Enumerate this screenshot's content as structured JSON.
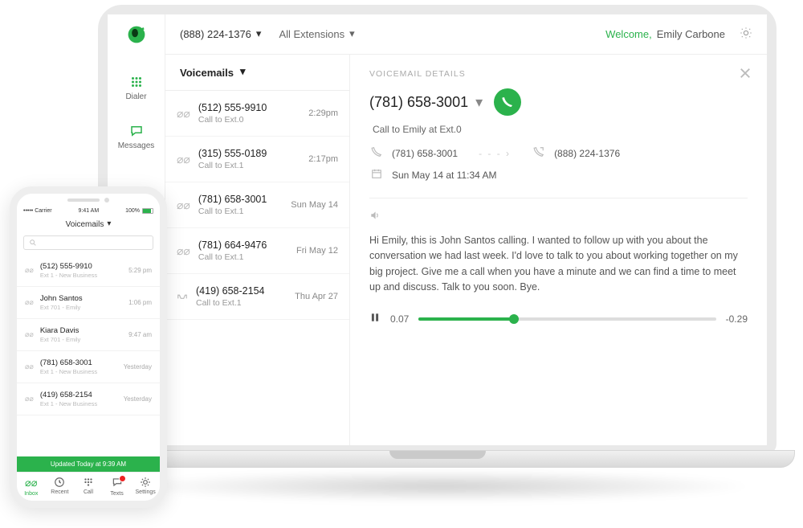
{
  "desktop": {
    "topbar": {
      "phone": "(888) 224-1376",
      "extensions_label": "All Extensions",
      "welcome": "Welcome,",
      "user": "Emily Carbone"
    },
    "rail": {
      "dialer": "Dialer",
      "messages": "Messages"
    },
    "vm_header": "Voicemails",
    "voicemails": [
      {
        "number": "(512) 555-9910",
        "ext": "Call to Ext.0",
        "time": "2:29pm"
      },
      {
        "number": "(315) 555-0189",
        "ext": "Call to Ext.1",
        "time": "2:17pm"
      },
      {
        "number": "(781) 658-3001",
        "ext": "Call to Ext.1",
        "time": "Sun May 14"
      },
      {
        "number": "(781) 664-9476",
        "ext": "Call to Ext.1",
        "time": "Fri May 12"
      },
      {
        "number": "(419) 658-2154",
        "ext": "Call to Ext.1",
        "time": "Thu Apr 27"
      }
    ],
    "details": {
      "title": "VOICEMAIL DETAILS",
      "number": "(781) 658-3001",
      "call_to": "Call to Emily at Ext.0",
      "from": "(781) 658-3001",
      "to": "(888) 224-1376",
      "date": "Sun May 14 at 11:34 AM",
      "transcript": "Hi Emily, this is John Santos calling. I wanted to follow up with you about the conversation we had last week. I'd love to talk to you about working together on my big project. Give me a call when you have a minute and we can find a time to meet up and discuss. Talk to you soon. Bye.",
      "elapsed": "0.07",
      "remaining": "-0.29",
      "progress_pct": 32
    }
  },
  "phone": {
    "carrier": "••••• Carrier",
    "clock": "9:41 AM",
    "battery": "100%",
    "header": "Voicemails",
    "rows": [
      {
        "label": "(512) 555-9910",
        "sub": "Ext 1 - New Business",
        "time": "5:29 pm"
      },
      {
        "label": "John Santos",
        "sub": "Ext 701 - Emily",
        "time": "1:06 pm"
      },
      {
        "label": "Kiara Davis",
        "sub": "Ext 701 - Emily",
        "time": "9:47 am"
      },
      {
        "label": "(781) 658-3001",
        "sub": "Ext 1 - New Business",
        "time": "Yesterday"
      },
      {
        "label": "(419) 658-2154",
        "sub": "Ext 1 - New Business",
        "time": "Yesterday"
      }
    ],
    "updated": "Updated Today at 9:39 AM",
    "tabs": {
      "inbox": "Inbox",
      "recent": "Recent",
      "call": "Call",
      "texts": "Texts",
      "settings": "Settings"
    }
  }
}
